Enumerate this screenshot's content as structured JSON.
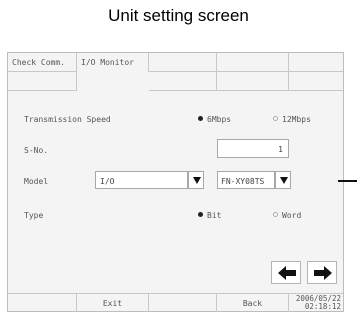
{
  "caption": "Unit setting screen",
  "tabs": {
    "check_comm": "Check Comm.",
    "io_monitor": "I/O Monitor"
  },
  "form": {
    "transmission_speed": {
      "label": "Transmission Speed",
      "options": [
        "6Mbps",
        "12Mbps"
      ],
      "selected": "6Mbps"
    },
    "s_no": {
      "label": "S-No.",
      "value": "1"
    },
    "model": {
      "label": "Model",
      "category": "I/O",
      "value": "FN-XY08TS"
    },
    "type": {
      "label": "Type",
      "options": [
        "Bit",
        "Word"
      ],
      "selected": "Bit"
    }
  },
  "icons": {
    "prev": "left-arrow-icon",
    "next": "right-arrow-icon",
    "dropdown": "triangle-down-icon"
  },
  "footer": {
    "exit": "Exit",
    "back": "Back",
    "date": "2006/05/22",
    "time": "02:18:12"
  }
}
